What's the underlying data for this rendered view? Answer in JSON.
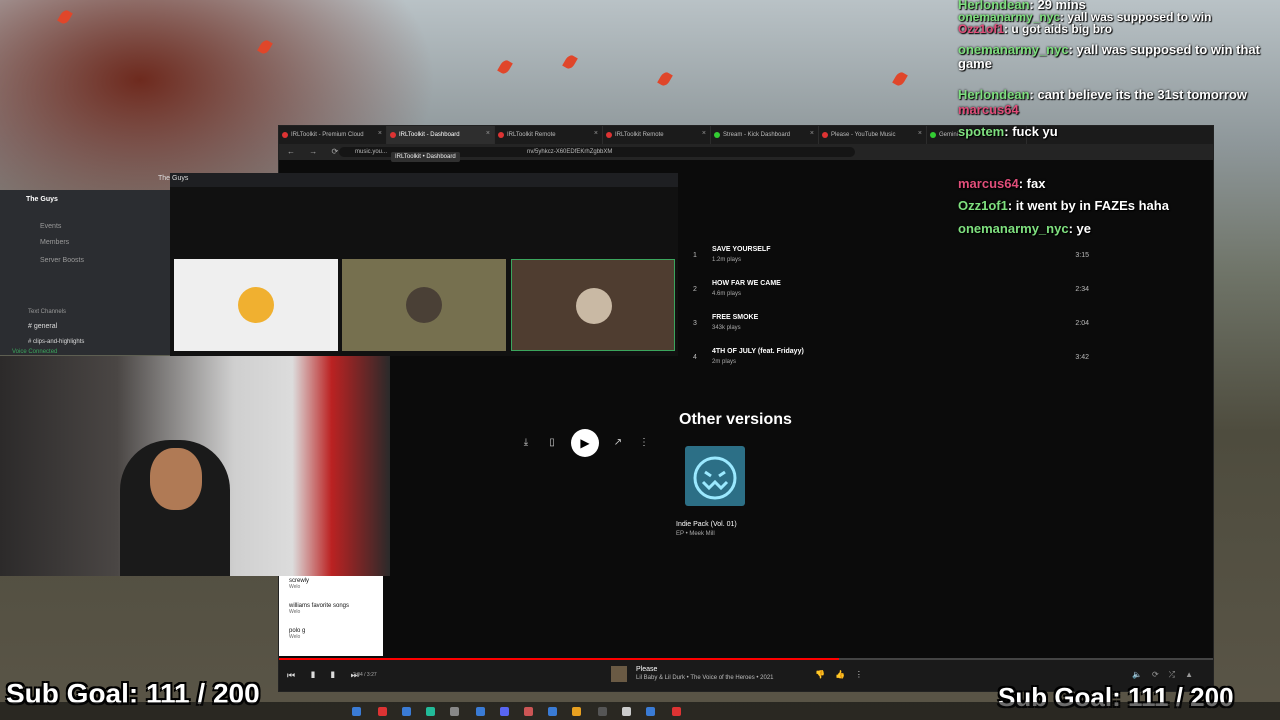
{
  "browser": {
    "tabs": [
      {
        "label": "IRLToolkit - Premium Cloud"
      },
      {
        "label": "IRLToolkit - Dashboard",
        "active": true
      },
      {
        "label": "IRLToolkit Remote"
      },
      {
        "label": "IRLToolkit Remote"
      },
      {
        "label": "Stream - Kick Dashboard"
      },
      {
        "label": "Please - YouTube Music"
      }
    ],
    "tooltip": "IRLToolkit • Dashboard",
    "url": "music.you...",
    "url_rest": "nv/5yhkcz-X60EDfEKrhZgbbXM",
    "extra_tab": "Gemini"
  },
  "music": {
    "tracks": [
      {
        "num": "1",
        "title": "SAVE YOURSELF",
        "plays": "1.2m plays",
        "duration": "3:15"
      },
      {
        "num": "2",
        "title": "HOW FAR WE CAME",
        "plays": "4.6m plays",
        "duration": "2:34"
      },
      {
        "num": "3",
        "title": "FREE SMOKE",
        "plays": "343k plays",
        "duration": "2:04"
      },
      {
        "num": "4",
        "title": "4TH OF JULY (feat. Fridayy)",
        "plays": "2m plays",
        "duration": "3:42"
      }
    ],
    "other_versions_title": "Other versions",
    "album": {
      "title": "Indie Pack (Vol. 01)",
      "subtitle": "EP • Meek Mill"
    },
    "queue": [
      {
        "title": "screwly",
        "sub": "Welo"
      },
      {
        "title": "williams favorite songs",
        "sub": "Welo"
      },
      {
        "title": "polo g",
        "sub": "Welo"
      }
    ],
    "player": {
      "time": "2:04 / 3:27",
      "progress": 0.6,
      "song": "Please",
      "artist_line": "Lil Baby & Lil Durk • The Voice of the Heroes • 2021"
    }
  },
  "discord": {
    "server": "The Guys",
    "items": [
      "Events",
      "Members",
      "Server Boosts"
    ],
    "section": "Text Channels",
    "channel": "general",
    "channel2": "clips-and-highlights",
    "voice": "Voice Connected",
    "call_title": "The Guys"
  },
  "chat": {
    "lines": [
      {
        "user": "Herlondean",
        "text": "29 mins"
      },
      {
        "user": "onemanarmy_nyc",
        "text": "yall was supposed to win"
      },
      {
        "user": "Ozz1of1",
        "text": "u got aids big bro"
      },
      {
        "user": "onemanarmy_nyc",
        "text": "yall was supposed to win that game"
      },
      {
        "user": "Herlondean",
        "text": "cant believe its the 31st tomorrow"
      },
      {
        "user": "marcus64",
        "text": ""
      },
      {
        "user": "spotem",
        "text": "fuck yu"
      },
      {
        "user": "marcus64",
        "text": "fax"
      },
      {
        "user": "Ozz1of1",
        "text": "it went by in FAZEs haha"
      },
      {
        "user": "onemanarmy_nyc",
        "text": "ye"
      }
    ]
  },
  "overlay": {
    "sub_goal_left": "Sub Goal: 111 / 200",
    "sub_goal_right": "Sub Goal: 111 / 200"
  },
  "colors": {
    "accent": "#ff0000",
    "chat_user": "#7fe07f",
    "chat_user_alt": "#e04e7a"
  }
}
